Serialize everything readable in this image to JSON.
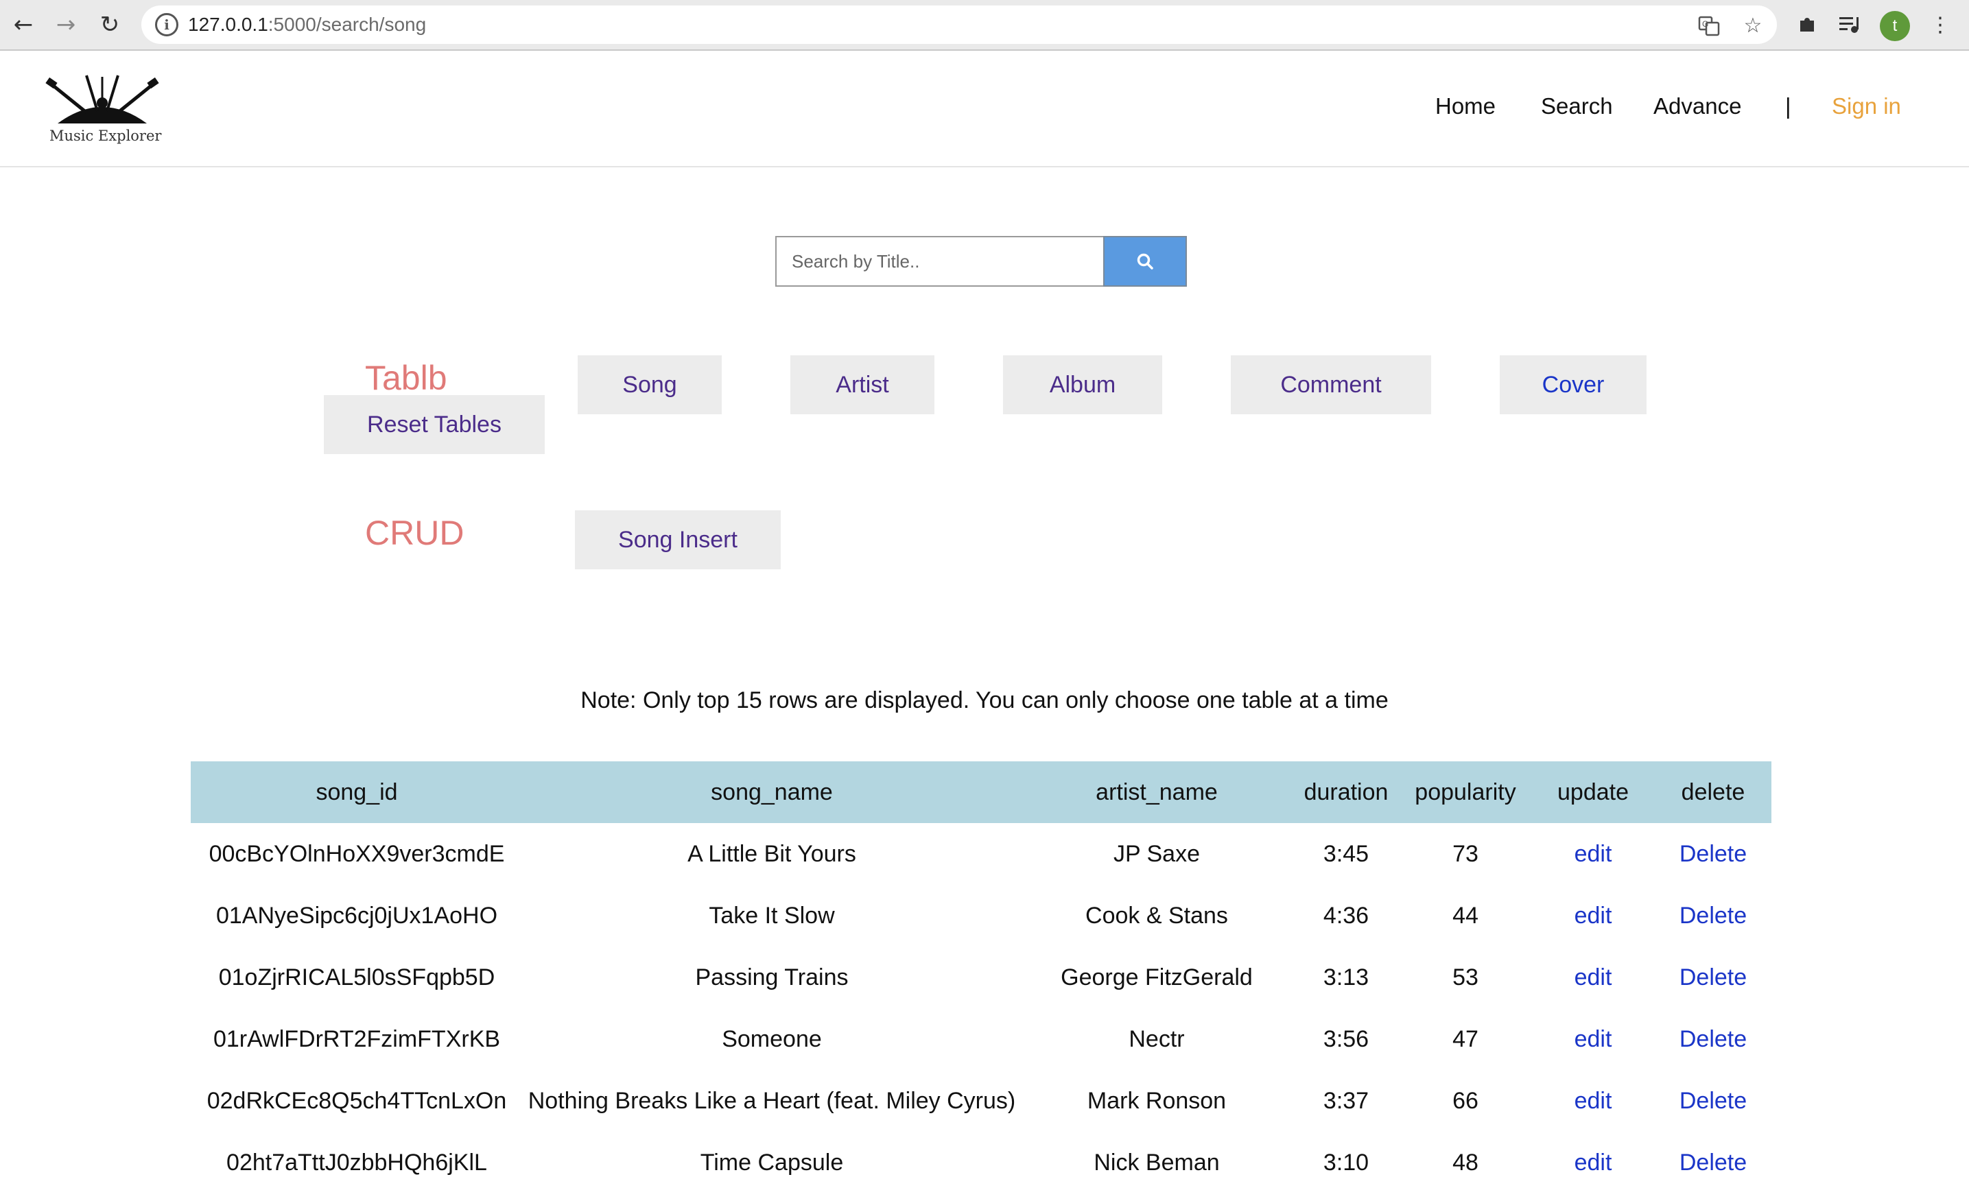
{
  "browser": {
    "url_host": "127.0.0.1",
    "url_rest": ":5000/search/song",
    "profile_initial": "t"
  },
  "site": {
    "logo_text": "Music Explorer",
    "nav": {
      "home": "Home",
      "search": "Search",
      "advance": "Advance",
      "separator": "|",
      "signin": "Sign in"
    }
  },
  "search": {
    "placeholder": "Search by Title.."
  },
  "tables": {
    "label": "Tablb",
    "reset": "Reset Tables",
    "buttons": [
      "Song",
      "Artist",
      "Album",
      "Comment",
      "Cover"
    ]
  },
  "crud": {
    "label": "CRUD",
    "insert": "Song Insert"
  },
  "note": "Note: Only top 15 rows are displayed. You can only choose one table at a time",
  "table": {
    "headers": [
      "song_id",
      "song_name",
      "artist_name",
      "duration",
      "popularity",
      "update",
      "delete"
    ],
    "rows": [
      {
        "song_id": "00cBcYOlnHoXX9ver3cmdE",
        "song_name": "A Little Bit Yours",
        "artist_name": "JP Saxe",
        "duration": "3:45",
        "popularity": "73",
        "update": "edit",
        "delete": "Delete"
      },
      {
        "song_id": "01ANyeSipc6cj0jUx1AoHO",
        "song_name": "Take It Slow",
        "artist_name": "Cook & Stans",
        "duration": "4:36",
        "popularity": "44",
        "update": "edit",
        "delete": "Delete"
      },
      {
        "song_id": "01oZjrRICAL5l0sSFqpb5D",
        "song_name": "Passing Trains",
        "artist_name": "George FitzGerald",
        "duration": "3:13",
        "popularity": "53",
        "update": "edit",
        "delete": "Delete"
      },
      {
        "song_id": "01rAwlFDrRT2FzimFTXrKB",
        "song_name": "Someone",
        "artist_name": "Nectr",
        "duration": "3:56",
        "popularity": "47",
        "update": "edit",
        "delete": "Delete"
      },
      {
        "song_id": "02dRkCEc8Q5ch4TTcnLxOn",
        "song_name": "Nothing Breaks Like a Heart (feat. Miley Cyrus)",
        "artist_name": "Mark Ronson",
        "duration": "3:37",
        "popularity": "66",
        "update": "edit",
        "delete": "Delete"
      },
      {
        "song_id": "02ht7aTttJ0zbbHQh6jKlL",
        "song_name": "Time Capsule",
        "artist_name": "Nick Beman",
        "duration": "3:10",
        "popularity": "48",
        "update": "edit",
        "delete": "Delete"
      }
    ]
  },
  "colors": {
    "header_row": "#b3d6e0",
    "label": "#e07a78",
    "link": "#1a35c8",
    "signin": "#e8a23c",
    "search_button": "#5a9ae0"
  }
}
